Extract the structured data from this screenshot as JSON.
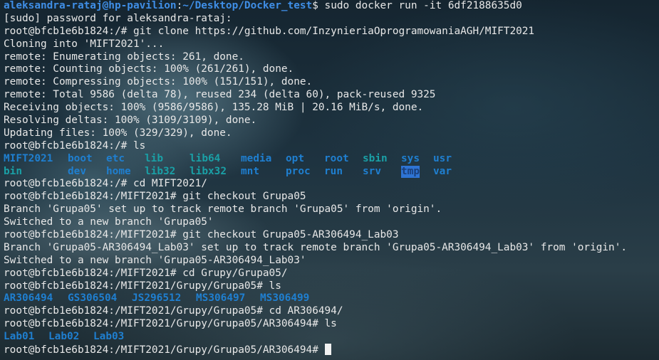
{
  "terminal": {
    "first_prompt": {
      "user_host": "aleksandra-rataj@hp-pavilion",
      "sep": ":",
      "path": "~/Desktop/Docker_test",
      "symbol": "$ ",
      "command": "sudo docker run -it 6df2188635d0"
    },
    "lines": [
      "[sudo] password for aleksandra-rataj:",
      "root@bfcb1e6b1824:/# git clone https://github.com/InzynieriaOprogramowaniaAGH/MIFT2021",
      "Cloning into 'MIFT2021'...",
      "remote: Enumerating objects: 261, done.",
      "remote: Counting objects: 100% (261/261), done.",
      "remote: Compressing objects: 100% (151/151), done.",
      "remote: Total 9586 (delta 78), reused 234 (delta 60), pack-reused 9325",
      "Receiving objects: 100% (9586/9586), 135.28 MiB | 20.16 MiB/s, done.",
      "Resolving deltas: 100% (3109/3109), done.",
      "Updating files: 100% (329/329), done.",
      "root@bfcb1e6b1824:/# ls"
    ],
    "ls_root": {
      "row1": [
        "MIFT2021",
        "boot",
        "etc",
        "lib",
        "lib64",
        "media",
        "opt",
        "root",
        "sbin",
        "sys",
        "usr"
      ],
      "row2": [
        "bin",
        "dev",
        "home",
        "lib32",
        "libx32",
        "mnt",
        "proc",
        "run",
        "srv",
        "tmp",
        "var"
      ]
    },
    "lines2": [
      "root@bfcb1e6b1824:/# cd MIFT2021/",
      "root@bfcb1e6b1824:/MIFT2021# git checkout Grupa05",
      "Branch 'Grupa05' set up to track remote branch 'Grupa05' from 'origin'.",
      "Switched to a new branch 'Grupa05'",
      "root@bfcb1e6b1824:/MIFT2021# git checkout Grupa05-AR306494_Lab03",
      "Branch 'Grupa05-AR306494_Lab03' set up to track remote branch 'Grupa05-AR306494_Lab03' from 'origin'.",
      "Switched to a new branch 'Grupa05-AR306494_Lab03'",
      "root@bfcb1e6b1824:/MIFT2021# cd Grupy/Grupa05/",
      "root@bfcb1e6b1824:/MIFT2021/Grupy/Grupa05# ls"
    ],
    "ls_grupa": [
      "AR306494",
      "GS306504",
      "JS296512",
      "MS306497",
      "MS306499"
    ],
    "lines3": [
      "root@bfcb1e6b1824:/MIFT2021/Grupy/Grupa05# cd AR306494/",
      "root@bfcb1e6b1824:/MIFT2021/Grupy/Grupa05/AR306494# ls"
    ],
    "ls_labs": [
      "Lab01",
      "Lab02",
      "Lab03"
    ],
    "final_prompt": "root@bfcb1e6b1824:/MIFT2021/Grupy/Grupa05/AR306494# ",
    "colors": {
      "prompt": "#3f8ee6",
      "directory": "#1f7fd0",
      "symlink": "#1aa0a6",
      "sticky_bg": "#2e74d4",
      "text": "#e8e8e8"
    }
  }
}
